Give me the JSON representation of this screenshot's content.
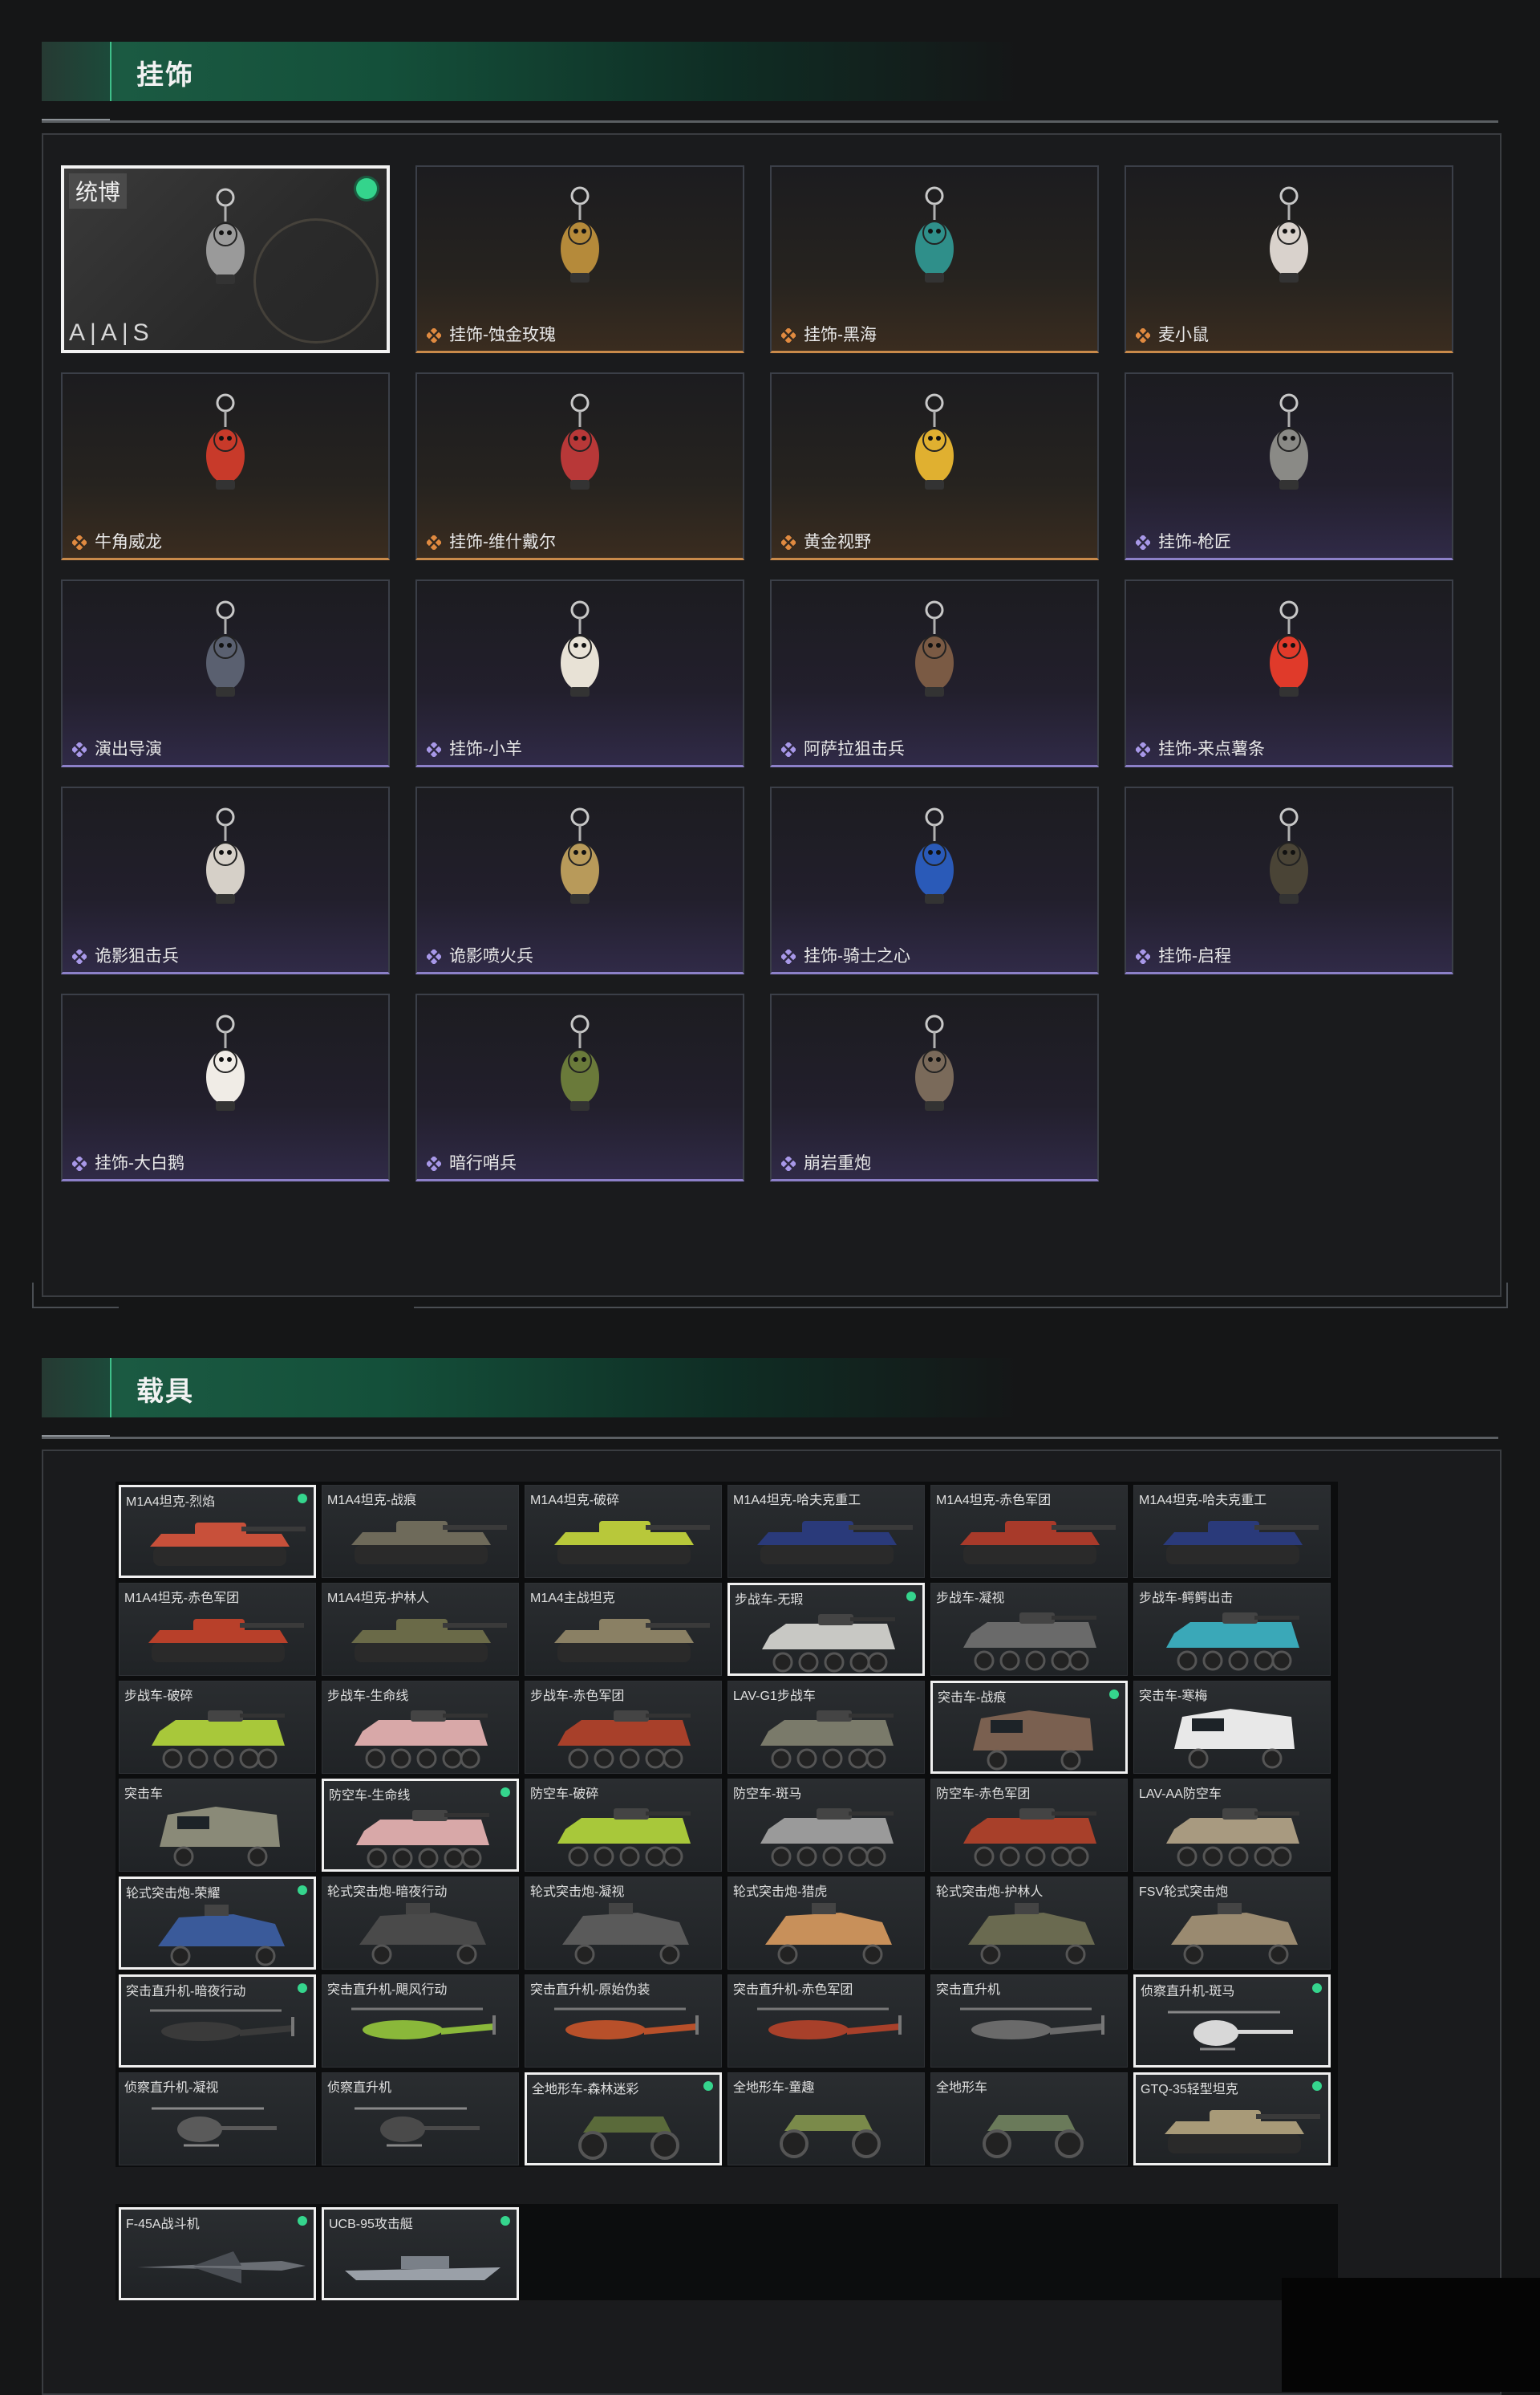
{
  "sections": {
    "pendants": {
      "title": "挂饰"
    },
    "vehicles": {
      "title": "载具"
    }
  },
  "pendants": [
    {
      "label": "",
      "rarity": "special",
      "tag": "统博",
      "brand": "A|A|S",
      "equipped": true,
      "color": "#9a9a9a",
      "icon": "knight-charm-icon"
    },
    {
      "label": "挂饰-蚀金玫瑰",
      "rarity": "orange",
      "color": "#b58a3a",
      "icon": "gold-rose-charm-icon"
    },
    {
      "label": "挂饰-黑海",
      "rarity": "orange",
      "color": "#2f8f8a",
      "icon": "anchor-charm-icon"
    },
    {
      "label": "麦小鼠",
      "rarity": "orange",
      "color": "#d9d2cc",
      "icon": "mouse-charm-icon"
    },
    {
      "label": "牛角威龙",
      "rarity": "orange",
      "color": "#c83a2a",
      "icon": "horned-dragon-charm-icon"
    },
    {
      "label": "挂饰-维什戴尔",
      "rarity": "orange",
      "color": "#b83838",
      "icon": "tag-charm-icon"
    },
    {
      "label": "黄金视野",
      "rarity": "orange",
      "color": "#e0b030",
      "icon": "duck-charm-icon"
    },
    {
      "label": "挂饰-枪匠",
      "rarity": "purple",
      "color": "#8a8a86",
      "icon": "tool-case-charm-icon"
    },
    {
      "label": "演出导演",
      "rarity": "purple",
      "color": "#5a6070",
      "icon": "director-charm-icon"
    },
    {
      "label": "挂饰-小羊",
      "rarity": "purple",
      "color": "#e8e2d6",
      "icon": "sheep-charm-icon"
    },
    {
      "label": "阿萨拉狙击兵",
      "rarity": "purple",
      "color": "#7a5a44",
      "icon": "sniper-charm-icon"
    },
    {
      "label": "挂饰-来点薯条",
      "rarity": "purple",
      "color": "#e03a2a",
      "icon": "fries-charm-icon"
    },
    {
      "label": "诡影狙击兵",
      "rarity": "purple",
      "color": "#d6d0c8",
      "icon": "ghost-sniper-charm-icon"
    },
    {
      "label": "诡影喷火兵",
      "rarity": "purple",
      "color": "#b89a5a",
      "icon": "flamethrower-charm-icon"
    },
    {
      "label": "挂饰-骑士之心",
      "rarity": "purple",
      "color": "#2a5ab8",
      "icon": "knight-heart-charm-icon"
    },
    {
      "label": "挂饰-启程",
      "rarity": "purple",
      "color": "#4a4436",
      "icon": "compass-charm-icon"
    },
    {
      "label": "挂饰-大白鹅",
      "rarity": "purple",
      "color": "#f0ece6",
      "icon": "goose-charm-icon"
    },
    {
      "label": "暗行哨兵",
      "rarity": "purple",
      "color": "#6a7a3a",
      "icon": "sentinel-charm-icon"
    },
    {
      "label": "崩岩重炮",
      "rarity": "purple",
      "color": "#7a6a5a",
      "icon": "artillery-charm-icon"
    }
  ],
  "vehicles": [
    {
      "name": "M1A4坦克-烈焰",
      "kind": "tank",
      "color": "#c8503a",
      "selected": true,
      "equipped": true
    },
    {
      "name": "M1A4坦克-战痕",
      "kind": "tank",
      "color": "#6e6a5a",
      "selected": false,
      "equipped": false
    },
    {
      "name": "M1A4坦克-破碎",
      "kind": "tank",
      "color": "#b8c83a",
      "selected": false,
      "equipped": false
    },
    {
      "name": "M1A4坦克-哈夫克重工",
      "kind": "tank",
      "color": "#2a3a7a",
      "selected": false,
      "equipped": false
    },
    {
      "name": "M1A4坦克-赤色军团",
      "kind": "tank",
      "color": "#a83a2a",
      "selected": false,
      "equipped": false
    },
    {
      "name": "M1A4坦克-哈夫克重工",
      "kind": "tank",
      "color": "#2a3a7a",
      "selected": false,
      "equipped": false
    },
    {
      "name": "M1A4坦克-赤色军团",
      "kind": "tank",
      "color": "#b8402a",
      "selected": false,
      "equipped": false
    },
    {
      "name": "M1A4坦克-护林人",
      "kind": "tank",
      "color": "#6a6a48",
      "selected": false,
      "equipped": false
    },
    {
      "name": "M1A4主战坦克",
      "kind": "tank",
      "color": "#8a8064",
      "selected": false,
      "equipped": false
    },
    {
      "name": "步战车-无瑕",
      "kind": "ifv",
      "color": "#c8c8c4",
      "selected": true,
      "equipped": true
    },
    {
      "name": "步战车-凝视",
      "kind": "ifv",
      "color": "#6a6a6a",
      "selected": false,
      "equipped": false
    },
    {
      "name": "步战车-鳄鳄出击",
      "kind": "ifv",
      "color": "#3aa8b8",
      "selected": false,
      "equipped": false
    },
    {
      "name": "步战车-破碎",
      "kind": "ifv",
      "color": "#a8c83a",
      "selected": false,
      "equipped": false
    },
    {
      "name": "步战车-生命线",
      "kind": "ifv",
      "color": "#d8a8a8",
      "selected": false,
      "equipped": false
    },
    {
      "name": "步战车-赤色军团",
      "kind": "ifv",
      "color": "#a8402a",
      "selected": false,
      "equipped": false
    },
    {
      "name": "LAV-G1步战车",
      "kind": "ifv",
      "color": "#7a7a6a",
      "selected": false,
      "equipped": false
    },
    {
      "name": "突击车-战痕",
      "kind": "mrap",
      "color": "#7a6050",
      "selected": true,
      "equipped": true
    },
    {
      "name": "突击车-寒梅",
      "kind": "mrap",
      "color": "#e8e8e8",
      "selected": false,
      "equipped": false
    },
    {
      "name": "突击车",
      "kind": "mrap",
      "color": "#8a8a78",
      "selected": false,
      "equipped": false
    },
    {
      "name": "防空车-生命线",
      "kind": "ifv",
      "color": "#d8a8a8",
      "selected": true,
      "equipped": true
    },
    {
      "name": "防空车-破碎",
      "kind": "ifv",
      "color": "#a8c83a",
      "selected": false,
      "equipped": false
    },
    {
      "name": "防空车-斑马",
      "kind": "ifv",
      "color": "#9a9a9a",
      "selected": false,
      "equipped": false
    },
    {
      "name": "防空车-赤色军团",
      "kind": "ifv",
      "color": "#a8402a",
      "selected": false,
      "equipped": false
    },
    {
      "name": "LAV-AA防空车",
      "kind": "ifv",
      "color": "#a89a80",
      "selected": false,
      "equipped": false
    },
    {
      "name": "轮式突击炮-荣耀",
      "kind": "buggy",
      "color": "#3a5a9a",
      "selected": true,
      "equipped": true
    },
    {
      "name": "轮式突击炮-暗夜行动",
      "kind": "buggy",
      "color": "#4a4a4a",
      "selected": false,
      "equipped": false
    },
    {
      "name": "轮式突击炮-凝视",
      "kind": "buggy",
      "color": "#5a5a5a",
      "selected": false,
      "equipped": false
    },
    {
      "name": "轮式突击炮-猎虎",
      "kind": "buggy",
      "color": "#c8905a",
      "selected": false,
      "equipped": false
    },
    {
      "name": "轮式突击炮-护林人",
      "kind": "buggy",
      "color": "#6a6a50",
      "selected": false,
      "equipped": false
    },
    {
      "name": "FSV轮式突击炮",
      "kind": "buggy",
      "color": "#9a8a70",
      "selected": false,
      "equipped": false
    },
    {
      "name": "突击直升机-暗夜行动",
      "kind": "heli",
      "color": "#3a3a3a",
      "selected": true,
      "equipped": true
    },
    {
      "name": "突击直升机-飓风行动",
      "kind": "heli",
      "color": "#8ab83a",
      "selected": false,
      "equipped": false
    },
    {
      "name": "突击直升机-原始伪装",
      "kind": "heli",
      "color": "#b8502a",
      "selected": false,
      "equipped": false
    },
    {
      "name": "突击直升机-赤色军团",
      "kind": "heli",
      "color": "#a8402a",
      "selected": false,
      "equipped": false
    },
    {
      "name": "突击直升机",
      "kind": "heli",
      "color": "#6a6a6a",
      "selected": false,
      "equipped": false
    },
    {
      "name": "侦察直升机-斑马",
      "kind": "scout",
      "color": "#d8d8d8",
      "selected": true,
      "equipped": true
    },
    {
      "name": "侦察直升机-凝视",
      "kind": "scout",
      "color": "#5a5a5a",
      "selected": false,
      "equipped": false
    },
    {
      "name": "侦察直升机",
      "kind": "scout",
      "color": "#4a4a4a",
      "selected": false,
      "equipped": false
    },
    {
      "name": "全地形车-森林迷彩",
      "kind": "atv",
      "color": "#5a6a3a",
      "selected": true,
      "equipped": true
    },
    {
      "name": "全地形车-童趣",
      "kind": "atv",
      "color": "#7a8a4a",
      "selected": false,
      "equipped": false
    },
    {
      "name": "全地形车",
      "kind": "atv",
      "color": "#6a7a5a",
      "selected": false,
      "equipped": false
    },
    {
      "name": "GTQ-35轻型坦克",
      "kind": "tank",
      "color": "#a89a78",
      "selected": true,
      "equipped": true
    },
    {
      "name": "F-45A战斗机",
      "kind": "jet",
      "color": "#6a6e74",
      "selected": true,
      "equipped": true
    },
    {
      "name": "UCB-95攻击艇",
      "kind": "boat",
      "color": "#9aa0a8",
      "selected": true,
      "equipped": true
    }
  ]
}
